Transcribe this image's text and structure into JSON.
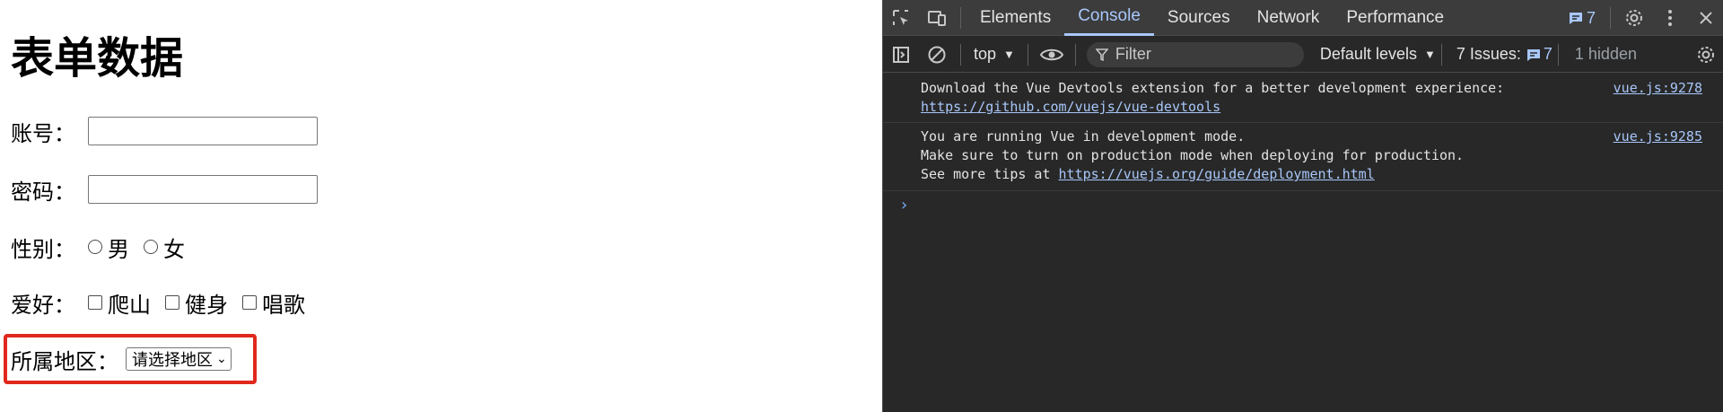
{
  "page": {
    "title": "表单数据",
    "account_label": "账号：",
    "password_label": "密码：",
    "gender_label": "性别：",
    "gender_options": [
      "男",
      "女"
    ],
    "hobby_label": "爱好：",
    "hobby_options": [
      "爬山",
      "健身",
      "唱歌"
    ],
    "region_label": "所属地区：",
    "region_select_value": "请选择地区",
    "highlight_color": "#e0281e"
  },
  "devtools": {
    "tabs": [
      "Elements",
      "Console",
      "Sources",
      "Network",
      "Performance"
    ],
    "active_tab": "Console",
    "issues_badge_count": "7",
    "toolbar": {
      "context": "top",
      "filter_placeholder": "Filter",
      "levels": "Default levels",
      "issues_label": "7 Issues:",
      "issues_count": "7",
      "hidden": "1 hidden"
    },
    "messages": [
      {
        "lines": [
          "Download the Vue Devtools extension for a better development experience:"
        ],
        "link": "https://github.com/vuejs/vue-devtools",
        "source": "vue.js:9278"
      },
      {
        "lines": [
          "You are running Vue in development mode.",
          "Make sure to turn on production mode when deploying for production."
        ],
        "tip_prefix": "See more tips at ",
        "link": "https://vuejs.org/guide/deployment.html",
        "source": "vue.js:9285"
      }
    ],
    "prompt": "›",
    "accent_color": "#a8c7fa"
  }
}
